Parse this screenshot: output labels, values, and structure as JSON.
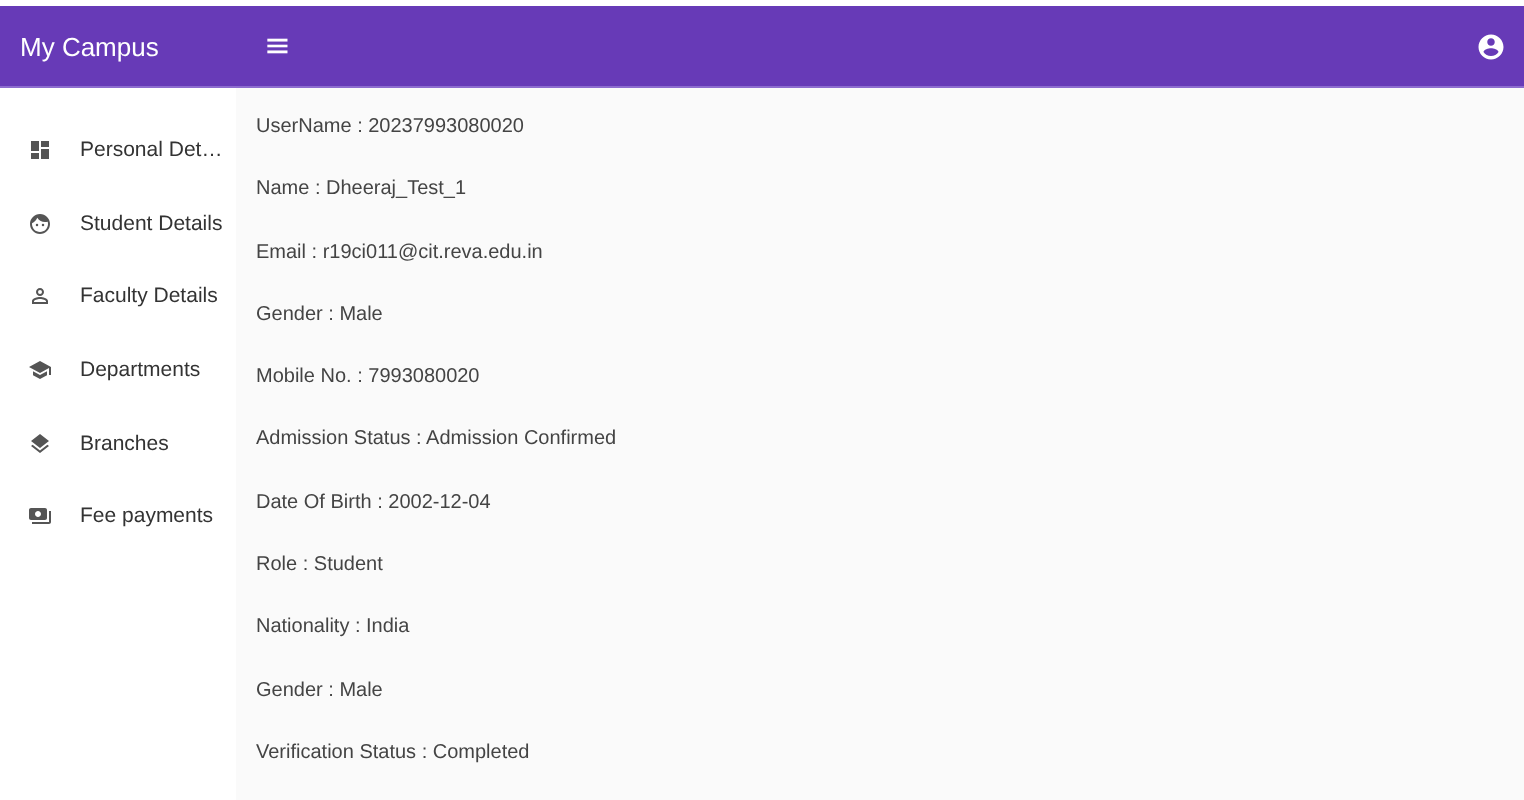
{
  "app_bar": {
    "title": "My Campus",
    "menu_glyph": "≡"
  },
  "sidebar": {
    "items": [
      {
        "label": "Personal Det…"
      },
      {
        "label": "Student Details"
      },
      {
        "label": "Faculty Details"
      },
      {
        "label": "Departments"
      },
      {
        "label": "Branches"
      },
      {
        "label": "Fee payments"
      }
    ]
  },
  "details": [
    "UserName : 20237993080020",
    "Name : Dheeraj_Test_1",
    "Email : r19ci011@cit.reva.edu.in",
    "Gender : Male",
    "Mobile No. : 7993080020",
    "Admission Status : Admission Confirmed",
    "Date Of Birth : 2002-12-04",
    "Role : Student",
    "Nationality : India",
    "Gender : Male",
    "Verification Status : Completed"
  ]
}
